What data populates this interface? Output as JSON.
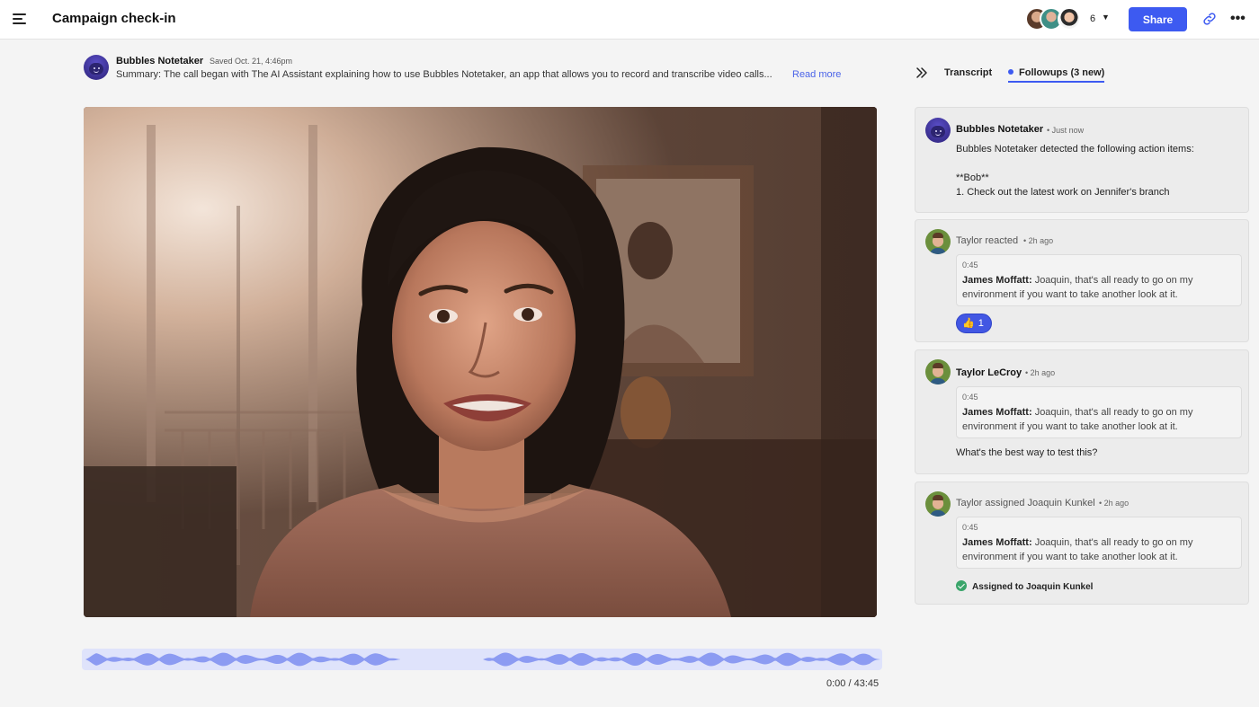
{
  "header": {
    "title": "Campaign check-in",
    "participant_count": "6",
    "share_label": "Share"
  },
  "summary": {
    "author": "Bubbles Notetaker",
    "saved": "Saved Oct. 21, 4:46pm",
    "text": "Summary: The call began with The AI Assistant explaining how to use Bubbles Notetaker, an app that allows you to record and transcribe video calls...",
    "read_more": "Read more"
  },
  "player": {
    "time": "0:00 / 43:45",
    "progress": 0
  },
  "panel": {
    "tabs": [
      {
        "label": "Transcript",
        "active": false
      },
      {
        "label": "Followups (3 new)",
        "active": true
      }
    ],
    "cards": [
      {
        "author": "Bubbles Notetaker",
        "time": "Just now",
        "intro": "Bubbles Notetaker detected the following action items:",
        "person": "**Bob**",
        "item": "1. Check out the latest work on Jennifer's branch"
      },
      {
        "action": "Taylor reacted",
        "time": "2h ago",
        "quote_time": "0:45",
        "quote_speaker": "James Moffatt:",
        "quote_text": "Joaquin, that's all ready to go on my environment if you want to take another look at it.",
        "reaction_emoji": "👍",
        "reaction_count": "1"
      },
      {
        "author": "Taylor LeCroy",
        "time": "2h ago",
        "quote_time": "0:45",
        "quote_speaker": "James Moffatt:",
        "quote_text": "Joaquin, that's all ready to go on my environment if you want to take another look at it.",
        "comment": "What's the best way to test this?"
      },
      {
        "action": "Taylor assigned Joaquin Kunkel",
        "time": "2h ago",
        "quote_time": "0:45",
        "quote_speaker": "James Moffatt:",
        "quote_text": "Joaquin, that's all ready to go on my environment if you want to take another look at it.",
        "assigned_label": "Assigned to Joaquin Kunkel"
      }
    ]
  },
  "colors": {
    "accent": "#3d5af1",
    "waveform": "#8c9bf2",
    "waveform_bg": "#dfe3fb",
    "success": "#3aa56a"
  },
  "icons": {
    "menu": "hamburger-icon",
    "caret": "chevron-down-icon",
    "link": "link-icon",
    "more": "more-horizontal-icon",
    "collapse": "chevrons-right-icon",
    "check": "check-circle-icon"
  }
}
